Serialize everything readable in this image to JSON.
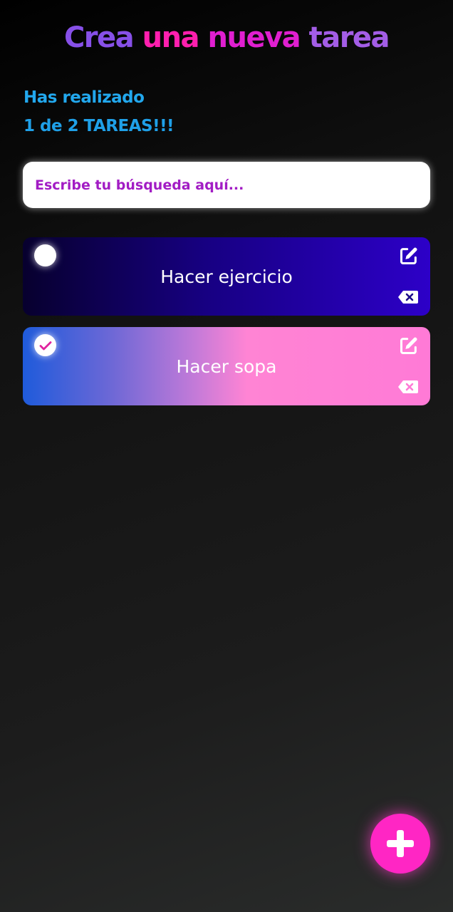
{
  "header": {
    "title_parts": [
      "Crea",
      "una",
      "nueva",
      "tarea"
    ]
  },
  "counter": {
    "line1": "Has realizado",
    "line2": "1 de 2 TAREAS!!!"
  },
  "search": {
    "placeholder": "Escribe tu búsqueda aquí..."
  },
  "todos": [
    {
      "text": "Hacer ejercicio",
      "completed": false
    },
    {
      "text": "Hacer sopa",
      "completed": true
    }
  ],
  "icons": {
    "check": "check-icon",
    "edit": "edit-icon",
    "delete": "backspace-icon",
    "add": "plus-icon"
  },
  "colors": {
    "accent_pink": "#ff26c4",
    "counter_blue": "#22a8ee",
    "search_text": "#a21cc4"
  }
}
